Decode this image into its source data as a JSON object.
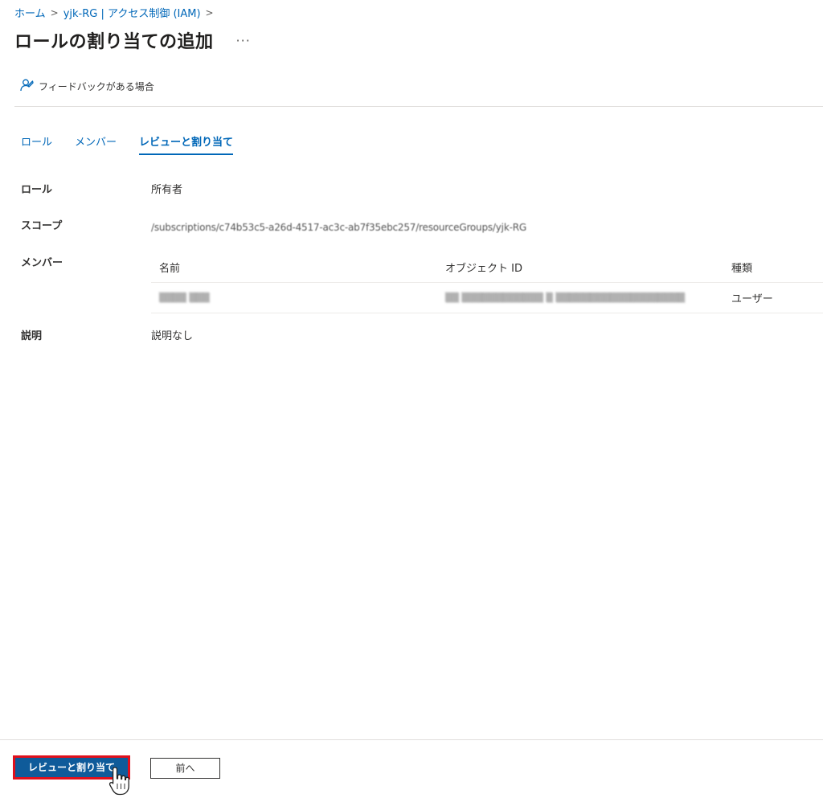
{
  "breadcrumb": {
    "items": [
      "ホーム",
      "yjk-RG | アクセス制御 (IAM)"
    ],
    "separator": ">"
  },
  "title": "ロールの割り当ての追加",
  "more_label": "···",
  "toolbar": {
    "feedback_label": "フィードバックがある場合"
  },
  "tabs": [
    {
      "label": "ロール"
    },
    {
      "label": "メンバー"
    },
    {
      "label": "レビューと割り当て"
    }
  ],
  "active_tab": "レビューと割り当て",
  "review": {
    "role_label": "ロール",
    "role_value": "所有者",
    "scope_label": "スコープ",
    "scope_value": "/subscriptions/c74b53c5-a26d-4517-ac3c-ab7f35ebc257/resourceGroups/yjk-RG",
    "members_label": "メンバー",
    "description_label": "説明",
    "description_value": "説明なし"
  },
  "members_table": {
    "columns": [
      "名前",
      "オブジェクト ID",
      "種類"
    ],
    "rows": [
      {
        "name": "▒▒▒▒ ▒▒▒",
        "object_id": "▒▒ ▒▒▒▒▒▒▒▒▒▒▒▒ ▒ ▒▒▒▒▒▒▒▒▒▒▒▒▒▒▒▒▒▒▒",
        "type": "ユーザー"
      }
    ]
  },
  "footer": {
    "primary_label": "レビューと割り当て",
    "secondary_label": "前へ"
  },
  "colors": {
    "accent": "#0067b8",
    "primary_button": "#0f5b9a",
    "highlight_border": "#e0101c"
  }
}
